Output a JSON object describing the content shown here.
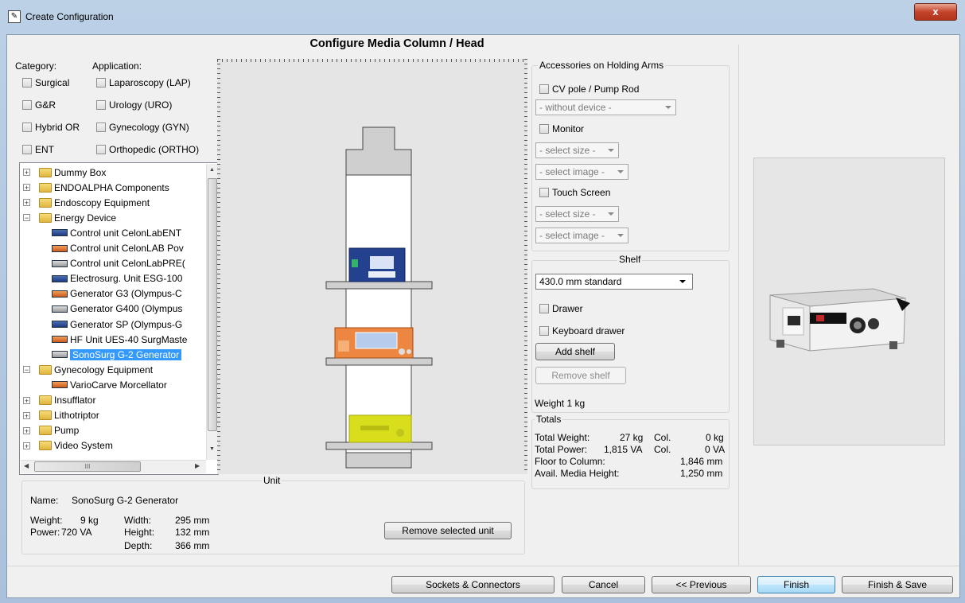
{
  "window": {
    "title": "Create Configuration",
    "close_label": "x"
  },
  "heading": "Configure Media Column / Head",
  "filters": {
    "category_label": "Category:",
    "application_label": "Application:",
    "categories": [
      "Surgical",
      "G&R",
      "Hybrid OR",
      "ENT"
    ],
    "applications": [
      "Laparoscopy (LAP)",
      "Urology (URO)",
      "Gynecology (GYN)",
      "Orthopedic (ORTHO)"
    ]
  },
  "tree": {
    "rows": [
      {
        "label": "Dummy Box",
        "type": "folder",
        "expanded": false
      },
      {
        "label": "ENDOALPHA Components",
        "type": "folder",
        "expanded": false
      },
      {
        "label": "Endoscopy Equipment",
        "type": "folder",
        "expanded": false
      },
      {
        "label": "Energy Device",
        "type": "folder",
        "expanded": true
      },
      {
        "label": "Control unit CelonLabENT",
        "type": "device"
      },
      {
        "label": "Control unit CelonLAB Pov",
        "type": "device"
      },
      {
        "label": "Control unit CelonLabPRE(",
        "type": "device"
      },
      {
        "label": "Electrosurg. Unit ESG-100",
        "type": "device"
      },
      {
        "label": "Generator G3 (Olympus-C",
        "type": "device"
      },
      {
        "label": "Generator G400 (Olympus",
        "type": "device"
      },
      {
        "label": "Generator SP (Olympus-G",
        "type": "device"
      },
      {
        "label": "HF Unit UES-40 SurgMaste",
        "type": "device"
      },
      {
        "label": "SonoSurg G-2 Generator",
        "type": "device",
        "selected": true
      },
      {
        "label": "Gynecology Equipment",
        "type": "folder",
        "expanded": true
      },
      {
        "label": "VarioCarve Morcellator",
        "type": "device"
      },
      {
        "label": "Insufflator",
        "type": "folder",
        "expanded": false
      },
      {
        "label": "Lithotriptor",
        "type": "folder",
        "expanded": false
      },
      {
        "label": "Pump",
        "type": "folder",
        "expanded": false
      },
      {
        "label": "Video System",
        "type": "folder",
        "expanded": false
      }
    ],
    "hscroll_grip": "III"
  },
  "accessories": {
    "legend": "Accessories on Holding Arms",
    "cv_pole": "CV pole / Pump Rod",
    "without_device": "- without device -",
    "monitor": "Monitor",
    "select_size": "- select size -",
    "select_image": "- select image -",
    "touch_screen": "Touch Screen"
  },
  "shelf": {
    "legend": "Shelf",
    "size_value": "430.0 mm standard",
    "drawer": "Drawer",
    "keyboard_drawer": "Keyboard drawer",
    "add_shelf": "Add shelf",
    "remove_shelf": "Remove shelf",
    "weight_text": "Weight  1 kg"
  },
  "totals": {
    "legend": "Totals",
    "total_weight_label": "Total Weight:",
    "total_weight_value": "27 kg",
    "col_label": "Col.",
    "col_weight_value": "0 kg",
    "total_power_label": "Total Power:",
    "total_power_value": "1,815 VA",
    "col_power_value": "0 VA",
    "floor_label": "Floor to Column:",
    "floor_value": "1,846 mm",
    "media_label": "Avail. Media Height:",
    "media_value": "1,250 mm"
  },
  "unit": {
    "legend": "Unit",
    "name_label": "Name:",
    "name_value": "SonoSurg G-2 Generator",
    "weight_label": "Weight:",
    "weight_value": "9 kg",
    "power_label": "Power:",
    "power_value": "720 VA",
    "width_label": "Width:",
    "width_value": "295 mm",
    "height_label": "Height:",
    "height_value": "132 mm",
    "depth_label": "Depth:",
    "depth_value": "366 mm",
    "remove_button": "Remove selected unit"
  },
  "footer": {
    "sockets": "Sockets & Connectors",
    "cancel": "Cancel",
    "previous": "<< Previous",
    "finish": "Finish",
    "finish_save": "Finish & Save"
  }
}
